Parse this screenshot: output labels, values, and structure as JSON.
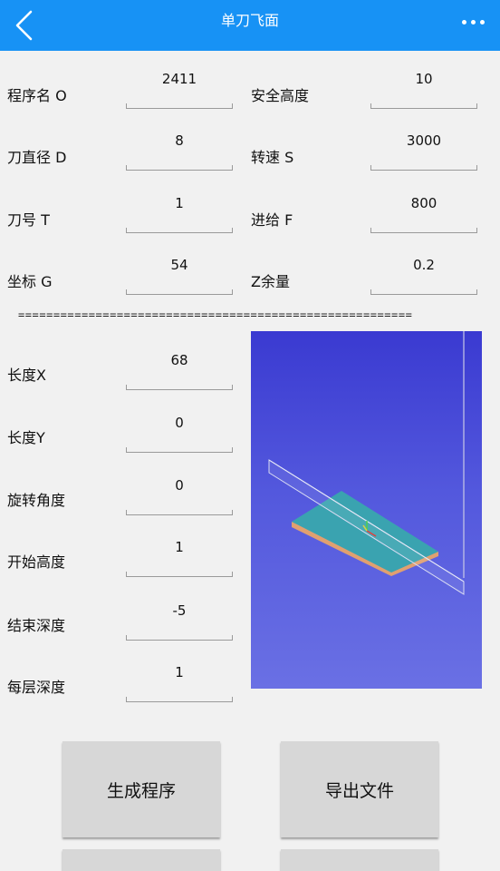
{
  "app_bar": {
    "title": "单刀飞面",
    "back_icon": "chevron-left-icon",
    "menu_icon": "more-dots-icon"
  },
  "params_left": [
    {
      "label": "程序名 O",
      "value": "2411"
    },
    {
      "label": "刀直径 D",
      "value": "8"
    },
    {
      "label": "刀号 T",
      "value": "1"
    },
    {
      "label": "坐标 G",
      "value": "54"
    }
  ],
  "params_right": [
    {
      "label": "安全高度",
      "value": "10"
    },
    {
      "label": "转速 S",
      "value": "3000"
    },
    {
      "label": "进给 F",
      "value": "800"
    },
    {
      "label": "Z余量",
      "value": "0.2"
    }
  ],
  "divider_text": "========================================================",
  "geometry": [
    {
      "label": "长度X",
      "value": "68"
    },
    {
      "label": "长度Y",
      "value": "0"
    },
    {
      "label": "旋转角度",
      "value": "0"
    },
    {
      "label": "开始高度",
      "value": "1"
    },
    {
      "label": "结束深度",
      "value": "-5"
    },
    {
      "label": "每层深度",
      "value": "1"
    }
  ],
  "buttons": {
    "generate": "生成程序",
    "export": "导出文件"
  },
  "colors": {
    "appbar": "#1792f5",
    "preview_top": "#3a3ad1",
    "preview_bottom": "#6a70e4",
    "plate_top": "#3aa3b0",
    "plate_edge": "#e0a070"
  }
}
